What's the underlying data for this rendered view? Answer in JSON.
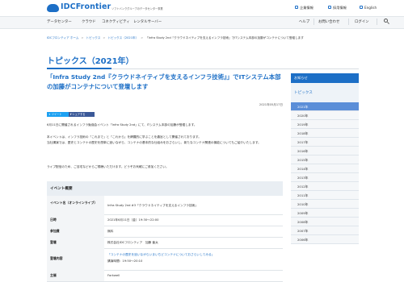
{
  "header": {
    "brand": "IDCFrontier",
    "tagline": "ソフトバンクグループのデータセンター事業",
    "links": [
      "企業情報",
      "採用情報",
      "English"
    ]
  },
  "nav": {
    "left": [
      "データセンター",
      "クラウド",
      "コネクティビティ",
      "レンタルサーバー"
    ],
    "right": [
      "ヘルプ",
      "お問い合わせ",
      "ログイン"
    ]
  },
  "breadcrumbs": [
    "IDCフロンティア ホーム",
    "トピックス",
    "トピックス（2021年）",
    "「Infra Study 2nd『クラウドネイティブを支えるインフラ技術』でITシステム本部の加藤がコンテナについて登壇します"
  ],
  "page_title": "トピックス（2021年）",
  "article": {
    "title": "「Infra Study 2nd『クラウドネイティブを支えるインフラ技術』」でITシステム本部の加藤がコンテナについて登壇します",
    "date": "2021年05月17日",
    "share_twitter": "ツイート",
    "share_facebook": "シェアする",
    "paragraphs": [
      "6月11日に開催されるインフラ勉強会イベント「Infra Study 2nd」にて、ITシステム本部の加藤が登壇します。",
      "本イベントは、インフラ技術の「これまで」と「これから」を網羅的に学ぶことを趣旨として開催されております。\n当社講演では、歴史とコンテナの歴史を簡単に追いながら、コンテナの基本的な仕組みをおさらいし、新たなコンテナ関連の機能についてもご紹介いたします。",
      "ライブ配信のため、ご自宅などからご視聴いただけます。どうぞお気軽にご参加ください。"
    ]
  },
  "event": {
    "heading": "イベント概要",
    "rows": [
      {
        "key": "イベント名（オンラインライブ）",
        "value": "Infra Study 2nd #3「クラウドネイティブを支えるインフラ技術」"
      },
      {
        "key": "日時",
        "value": "2021年6月11日（金）19:30〜22:00"
      },
      {
        "key": "参加費",
        "value": "無料"
      },
      {
        "key": "登壇",
        "value": "株式会社IDCフロンティア　加藤 章太"
      },
      {
        "key": "登壇内容",
        "value": "「コンテナの歴史を追いながらいまいちどコンテナについておさらいしてみる」",
        "value2": "講演時間：19:50〜20:10"
      },
      {
        "key": "主催",
        "value": "Forkwell"
      }
    ]
  },
  "sidebar": {
    "heading": "お知らせ",
    "topic": "トピックス",
    "years": [
      "2021年",
      "2020年",
      "2019年",
      "2018年",
      "2017年",
      "2016年",
      "2015年",
      "2014年",
      "2013年",
      "2012年",
      "2011年",
      "2010年",
      "2009年",
      "2008年",
      "2007年",
      "2006年"
    ],
    "selected_year": "2021年"
  },
  "colors": {
    "brand": "#1d6fc6",
    "sidebar_selected": "#5b8ed8",
    "twitter": "#1da1f2",
    "facebook": "#3b5998"
  }
}
